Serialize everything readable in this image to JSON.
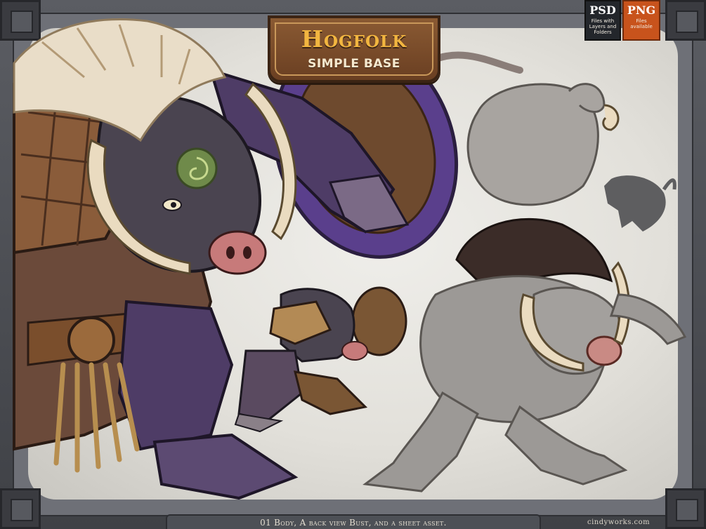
{
  "title": {
    "main": "Hogfolk",
    "subtitle": "SIMPLE BASE"
  },
  "badges": {
    "psd": {
      "label": "PSD",
      "description": "Files with Layers and Folders"
    },
    "png": {
      "label": "PNG",
      "description": "Files available"
    }
  },
  "caption": "01 Body, A back view Bust, and a sheet asset.",
  "watermark": "cindyworks.com",
  "colors": {
    "frame": "#4a4c52",
    "canvas": "#e8e6e1",
    "plaque": "#6a3f22",
    "title_gold": "#f2b640",
    "png_badge": "#c8531c",
    "psd_badge": "#23262b",
    "hog_skin": "#9c9996",
    "armor_purple": "#5a3f8c"
  }
}
